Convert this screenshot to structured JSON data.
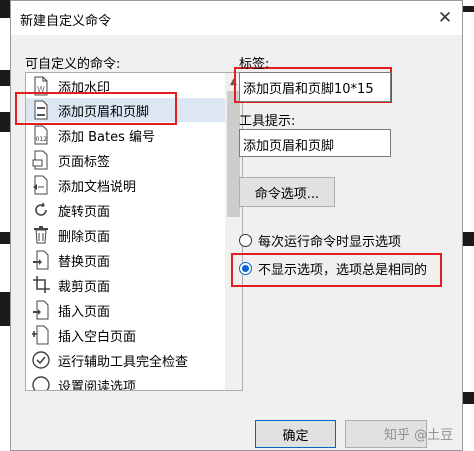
{
  "dialog": {
    "title": "新建自定义命令",
    "close_glyph": "✕"
  },
  "left": {
    "label": "可自定义的命令:",
    "items": [
      {
        "label": "添加水印",
        "icon": "watermark-doc-icon"
      },
      {
        "label": "添加页眉和页脚",
        "icon": "header-footer-doc-icon",
        "selected": true
      },
      {
        "label": "添加 Bates 编号",
        "icon": "bates-numbering-icon"
      },
      {
        "label": "页面标签",
        "icon": "page-label-icon"
      },
      {
        "label": "添加文档说明",
        "icon": "document-description-icon"
      },
      {
        "label": "旋转页面",
        "icon": "rotate-page-icon"
      },
      {
        "label": "删除页面",
        "icon": "trash-icon"
      },
      {
        "label": "替换页面",
        "icon": "replace-page-icon"
      },
      {
        "label": "裁剪页面",
        "icon": "crop-icon"
      },
      {
        "label": "插入页面",
        "icon": "insert-page-icon"
      },
      {
        "label": "插入空白页面",
        "icon": "insert-blank-page-icon"
      },
      {
        "label": "运行辅助工具完全检查",
        "icon": "accessibility-check-icon"
      },
      {
        "label": "设置阅读选项",
        "icon": "reading-options-icon"
      }
    ]
  },
  "right": {
    "label_caption": "标签:",
    "label_value": "添加页眉和页脚10*15",
    "tooltip_caption": "工具提示:",
    "tooltip_value": "添加页眉和页脚",
    "options_button": "命令选项...",
    "radio_each_run": "每次运行命令时显示选项",
    "radio_no_show": "不显示选项，选项总是相同的"
  },
  "footer": {
    "ok": "确定",
    "watermark": "知乎 @土豆"
  },
  "colors": {
    "highlight": "#e02020",
    "accent": "#0a64c8",
    "selection": "#dde7f4"
  }
}
